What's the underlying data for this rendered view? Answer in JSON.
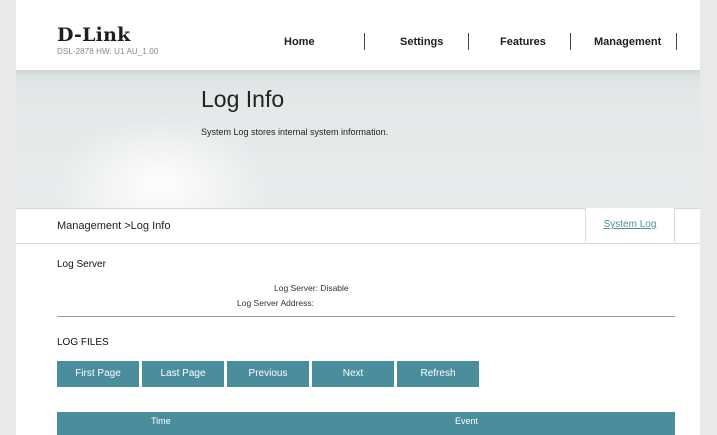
{
  "header": {
    "brand": "D-Link",
    "model_info": "DSL-2878  HW: U1  AU_1.00",
    "nav": [
      "Home",
      "Settings",
      "Features",
      "Management"
    ]
  },
  "banner": {
    "title": "Log Info",
    "description": "System Log stores internal system information."
  },
  "breadcrumb": {
    "path": "Management >Log Info",
    "tab_label": "System Log"
  },
  "log_server": {
    "heading": "Log Server",
    "status_line": "Log Server: Disable",
    "address_line": "Log Server Address:"
  },
  "log_files": {
    "heading": "LOG FILES",
    "buttons": [
      "First Page",
      "Last Page",
      "Previous",
      "Next",
      "Refresh"
    ],
    "columns": [
      "Time",
      "Event"
    ]
  },
  "colors": {
    "accent": "#4a8e9e",
    "link": "#4d8fa6",
    "page_background": "#e9e9e9"
  }
}
